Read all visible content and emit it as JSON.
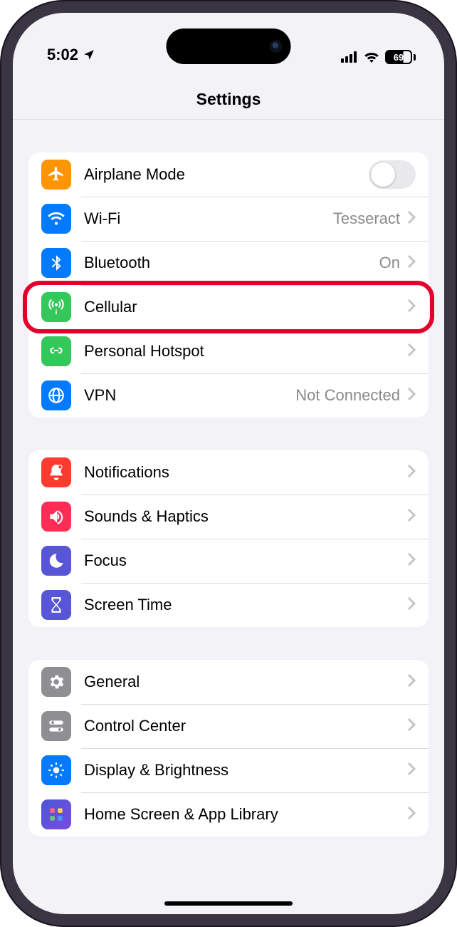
{
  "status": {
    "time": "5:02",
    "battery": "69"
  },
  "title": "Settings",
  "groups": [
    {
      "rows": [
        {
          "label": "Airplane Mode",
          "value": "",
          "type": "toggle"
        },
        {
          "label": "Wi-Fi",
          "value": "Tesseract",
          "type": "nav"
        },
        {
          "label": "Bluetooth",
          "value": "On",
          "type": "nav"
        },
        {
          "label": "Cellular",
          "value": "",
          "type": "nav"
        },
        {
          "label": "Personal Hotspot",
          "value": "",
          "type": "nav"
        },
        {
          "label": "VPN",
          "value": "Not Connected",
          "type": "nav"
        }
      ]
    },
    {
      "rows": [
        {
          "label": "Notifications",
          "value": "",
          "type": "nav"
        },
        {
          "label": "Sounds & Haptics",
          "value": "",
          "type": "nav"
        },
        {
          "label": "Focus",
          "value": "",
          "type": "nav"
        },
        {
          "label": "Screen Time",
          "value": "",
          "type": "nav"
        }
      ]
    },
    {
      "rows": [
        {
          "label": "General",
          "value": "",
          "type": "nav"
        },
        {
          "label": "Control Center",
          "value": "",
          "type": "nav"
        },
        {
          "label": "Display & Brightness",
          "value": "",
          "type": "nav"
        },
        {
          "label": "Home Screen & App Library",
          "value": "",
          "type": "nav"
        }
      ]
    }
  ],
  "highlight": "Cellular"
}
